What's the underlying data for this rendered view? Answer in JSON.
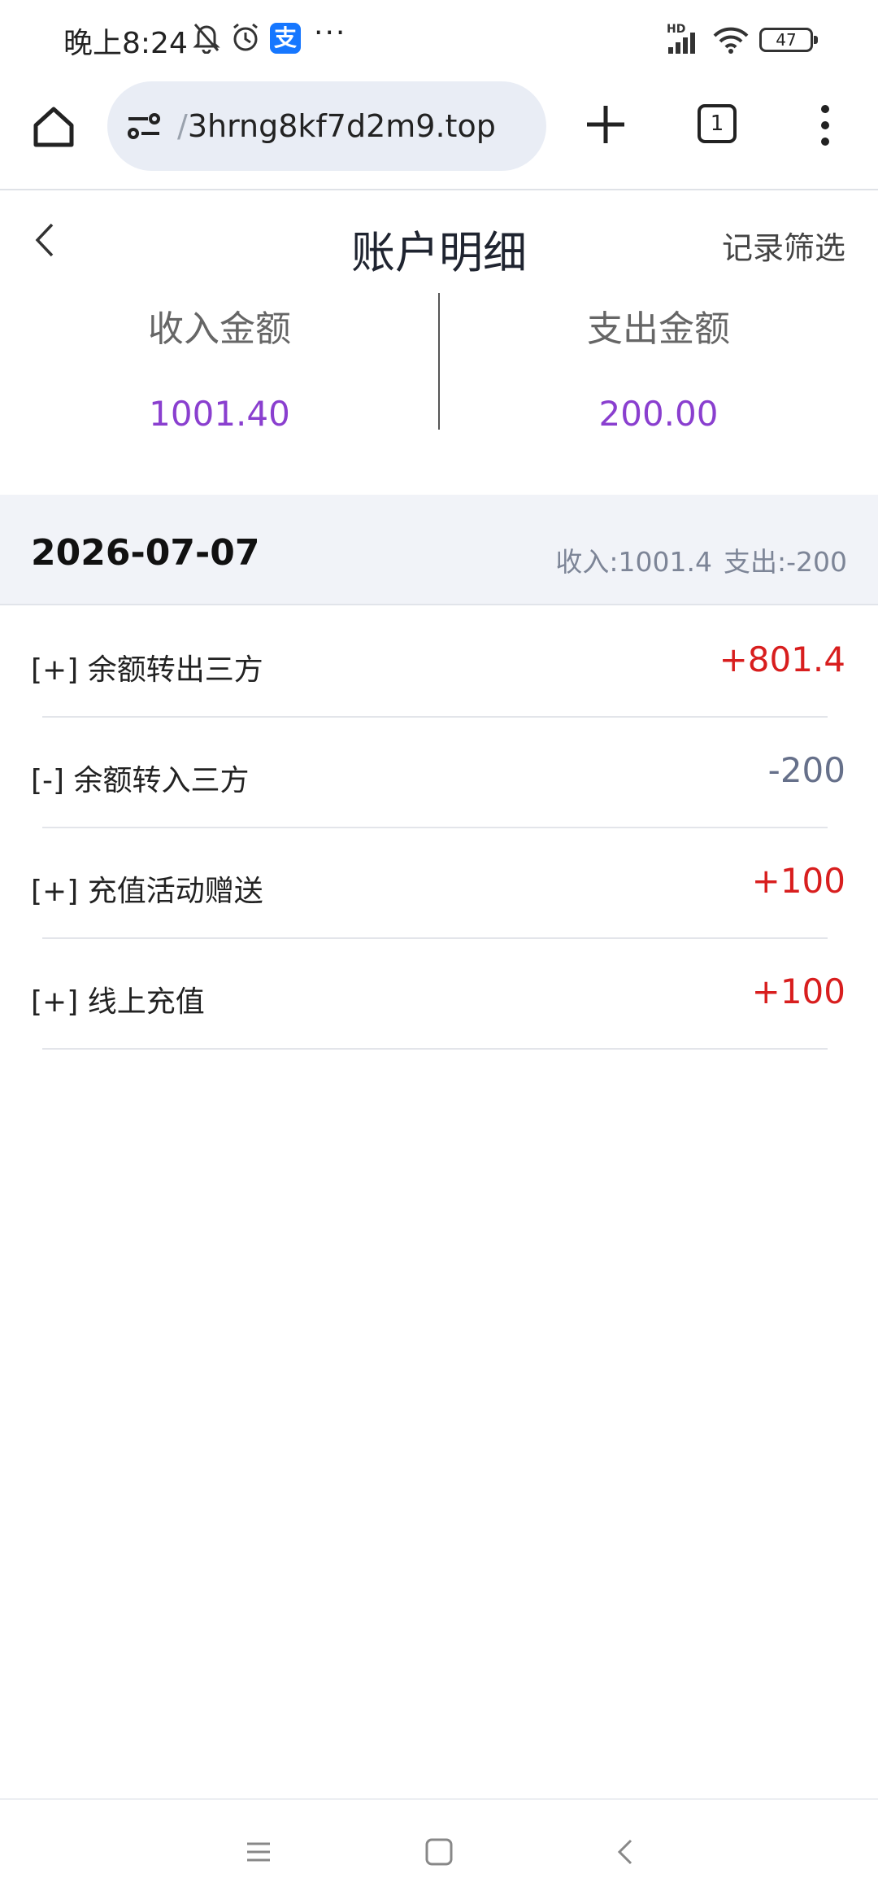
{
  "status_bar": {
    "time": "晚上8:24",
    "app_badge": "支",
    "more": "···",
    "network": "HD",
    "battery": "47"
  },
  "browser": {
    "url_prefix": "/",
    "url": "3hrng8kf7d2m9.top",
    "tab_count": "1"
  },
  "header": {
    "title": "账户明细",
    "filter_label": "记录筛选"
  },
  "summary": {
    "income_label": "收入金额",
    "income_value": "1001.40",
    "expense_label": "支出金额",
    "expense_value": "200.00"
  },
  "group": {
    "date": "2026-07-07",
    "income": "收入:1001.4",
    "expense": "支出:-200"
  },
  "records": [
    {
      "name": "[+] 余额转出三方",
      "amount": "+801.4"
    },
    {
      "name": "[-] 余额转入三方",
      "amount": "-200"
    },
    {
      "name": "[+] 充值活动赠送",
      "amount": "+100"
    },
    {
      "name": "[+] 线上充值",
      "amount": "+100"
    }
  ],
  "colors": {
    "accent_purple": "#8a3fcf",
    "amount_positive": "#d81e1e",
    "amount_negative": "#66708a"
  }
}
